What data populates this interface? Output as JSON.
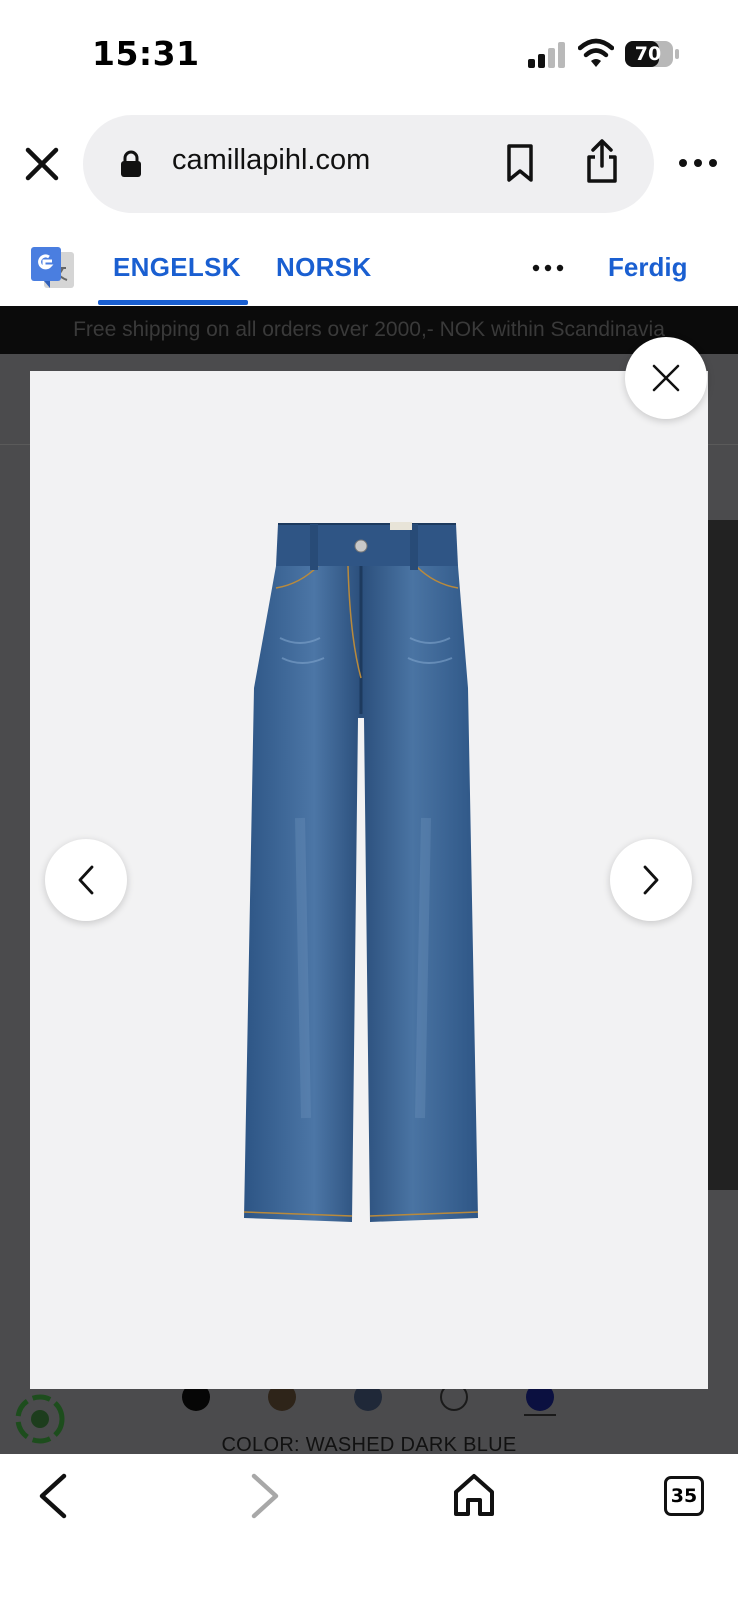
{
  "status_bar": {
    "time": "15:31",
    "battery_level": "70",
    "icons": [
      "signal-icon",
      "wifi-icon",
      "battery-icon"
    ]
  },
  "browser": {
    "url": "camillapihl.com",
    "icons": [
      "close-icon",
      "lock-icon",
      "bookmark-icon",
      "share-icon",
      "more-icon"
    ]
  },
  "translate_bar": {
    "tabs": [
      {
        "label": "ENGELSK",
        "selected": true
      },
      {
        "label": "NORSK",
        "selected": false
      }
    ],
    "done_label": "Ferdig",
    "accent_color": "#1a5fd1"
  },
  "page": {
    "promo_banner": "Free shipping on all orders over 2000,- NOK within Scandinavia",
    "color_label": "COLOR: WASHED DARK BLUE",
    "swatch_colors": [
      "#060606",
      "#2e2419",
      "#1f2838",
      "#ffffff",
      "#0b1040"
    ]
  },
  "lightbox": {
    "image_subject": "wide-leg-jeans",
    "icons": [
      "close-icon",
      "chevron-left-icon",
      "chevron-right-icon"
    ]
  },
  "toolbar": {
    "tab_count": "35",
    "icons": [
      "back-arrow-icon",
      "forward-arrow-icon",
      "home-icon",
      "tabs-icon"
    ]
  }
}
